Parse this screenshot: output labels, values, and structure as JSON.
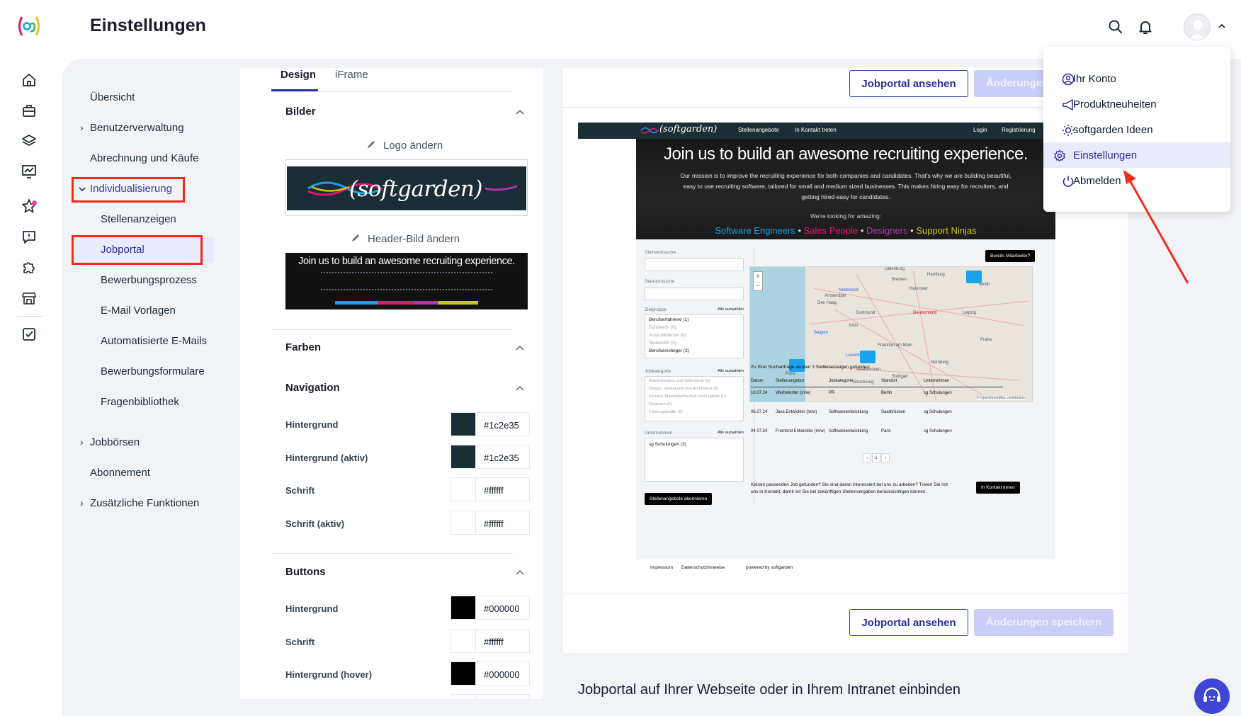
{
  "app": {
    "title": "Einstellungen"
  },
  "settings_nav": {
    "items": [
      {
        "label": "Übersicht"
      },
      {
        "label": "Benutzerverwaltung"
      },
      {
        "label": "Abrechnung und Käufe"
      },
      {
        "label": "Individualisierung"
      },
      {
        "label": "Stellenanzeigen"
      },
      {
        "label": "Jobportal"
      },
      {
        "label": "Bewerbungsprozess"
      },
      {
        "label": "E-Mail Vorlagen"
      },
      {
        "label": "Automatisierte E-Mails"
      },
      {
        "label": "Bewerbungsformulare"
      },
      {
        "label": "Fragenbibliothek"
      },
      {
        "label": "Jobbörsen"
      },
      {
        "label": "Abonnement"
      },
      {
        "label": "Zusätzliche Funktionen"
      }
    ]
  },
  "design_panel": {
    "tabs": [
      {
        "label": "Design"
      },
      {
        "label": "iFrame"
      }
    ],
    "bilder": {
      "title": "Bilder",
      "logo_edit": "Logo ändern",
      "logo_text": "(softgarden)",
      "header_edit": "Header-Bild ändern",
      "header_text": "Join us to build an awesome recruiting experience."
    },
    "farben": {
      "title": "Farben"
    },
    "navigation": {
      "title": "Navigation",
      "rows": [
        {
          "label": "Hintergrund",
          "color": "#1c2e35",
          "value": "#1c2e35"
        },
        {
          "label": "Hintergrund (aktiv)",
          "color": "#1c2e35",
          "value": "#1c2e35"
        },
        {
          "label": "Schrift",
          "color": "#ffffff",
          "value": "#ffffff"
        },
        {
          "label": "Schrift (aktiv)",
          "color": "#ffffff",
          "value": "#ffffff"
        }
      ]
    },
    "buttons": {
      "title": "Buttons",
      "rows": [
        {
          "label": "Hintergrund",
          "color": "#000000",
          "value": "#000000"
        },
        {
          "label": "Schrift",
          "color": "#ffffff",
          "value": "#ffffff"
        },
        {
          "label": "Hintergrund (hover)",
          "color": "#000000",
          "value": "#000000"
        }
      ]
    }
  },
  "preview": {
    "view_button": "Jobportal ansehen",
    "save_button_top": "Änderungen",
    "save_button": "Änderungen speichern",
    "embed_title": "Jobportal auf Ihrer Webseite oder in Ihrem Intranet einbinden",
    "mock": {
      "logo": "(softgarden)",
      "nav_left": [
        "Stellenangebote",
        "In Kontakt treten"
      ],
      "nav_right": [
        "Login",
        "Registrierung"
      ],
      "hero_title": "Join us to build an awesome recruiting experience.",
      "hero_text": "Our mission is to improve the recruiting experience for both companies and candidates. That's why we are building beautiful, easy to use recruiting software, tailored for small and medium sized businesses. This makes hiring easy for recruiters, and getting hired easy for candidates.",
      "hero_looking": "We're looking for amazing:",
      "roles": [
        {
          "label": "Software Engineers",
          "color": "#18a0e0"
        },
        {
          "label": "Sales People",
          "color": "#e0186e"
        },
        {
          "label": "Designers",
          "color": "#a83aa8"
        },
        {
          "label": "Support Ninjas",
          "color": "#c8c81a"
        }
      ],
      "bereits_btn": "Bereits Mitarbeiter?",
      "filters": {
        "stichwort": "Stichwortsuche",
        "standort": "Standortsuche",
        "zielgruppe": "Zielgruppe",
        "select_all": "Alle auswählen",
        "zielgruppe_items": [
          "Berufserfahrene (1)",
          "Schüler/in (0)",
          "Auszubildende (0)",
          "Student/in (0)",
          "Berufseinsteiger (2)"
        ],
        "jobkategorie": "Jobkategorie",
        "jobkategorie_items": [
          "Administration und Sekretariat (0)",
          "Design, Gestaltung und Architektur (0)",
          "Einkauf, Materialwirtschaft und Logistik (0)",
          "Finanzen (0)",
          "Führungskräfte (0)"
        ],
        "unternehmen": "Unternehmen",
        "unternehmen_items": [
          "sg Schulungen (3)"
        ],
        "subscribe_btn": "Stellenangebote abonnieren"
      },
      "map_cities": [
        "Oldenburg",
        "Bremen",
        "Hamburg",
        "Berlin",
        "Hannover",
        "Amsterdam",
        "Nederland",
        "Den Haag",
        "Dortmund",
        "Deutschland",
        "Leipzig",
        "Köln",
        "Belgien",
        "Frankfurt am Main",
        "Luxembourg",
        "Saarbrücken",
        "Paris",
        "Strasbourg",
        "Stuttgart",
        "Nürnberg",
        "Praha"
      ],
      "map_attrib": "© OpenStreetMap contributors",
      "results_summary": "Zu Ihrer Suchanfrage wurden 3 Stellenanzeigen gefunden:",
      "result_headers": [
        "Datum",
        "Stellenangebot",
        "Jobkategorie",
        "Standort",
        "Unternehmen"
      ],
      "results": [
        {
          "date": "18.07.24",
          "title": "Werbetexter (m/w)",
          "category": "PR",
          "location": "Berlin",
          "company": "sg Schulungen"
        },
        {
          "date": "06.07.24",
          "title": "Java Entwickler (m/w)",
          "category": "Softwareentwicklung",
          "location": "Saarbrücken",
          "company": "sg Schulungen"
        },
        {
          "date": "04.07.24",
          "title": "Frontend Entwickler (m/w)",
          "category": "Softwareentwicklung",
          "location": "Paris",
          "company": "sg Schulungen"
        }
      ],
      "pagination": [
        "‹",
        "1",
        "›"
      ],
      "footer_text": "Keinen passenden Job gefunden? Sie sind daran interessiert bei uns zu arbeiten? Treten Sie mit uns in Kontakt, damit wir Sie bei zukünftigen Stellenvergaben berücksichtigen können.",
      "contact_btn": "In Kontakt treten",
      "legal": [
        "Impressum",
        "Datenschutzhinweise",
        "powered by softgarden"
      ]
    }
  },
  "user_menu": {
    "items": [
      {
        "label": "Ihr Konto",
        "icon": "user-circle-icon"
      },
      {
        "label": "Produktneuheiten",
        "icon": "megaphone-icon"
      },
      {
        "label": "softgarden Ideen",
        "icon": "lightbulb-icon"
      },
      {
        "label": "Einstellungen",
        "icon": "gear-icon"
      },
      {
        "label": "Abmelden",
        "icon": "power-icon"
      }
    ]
  },
  "colors": {
    "accent": "#2b2f9e",
    "highlight": "#ef2b1c",
    "active_bg": "#e9eafb"
  }
}
